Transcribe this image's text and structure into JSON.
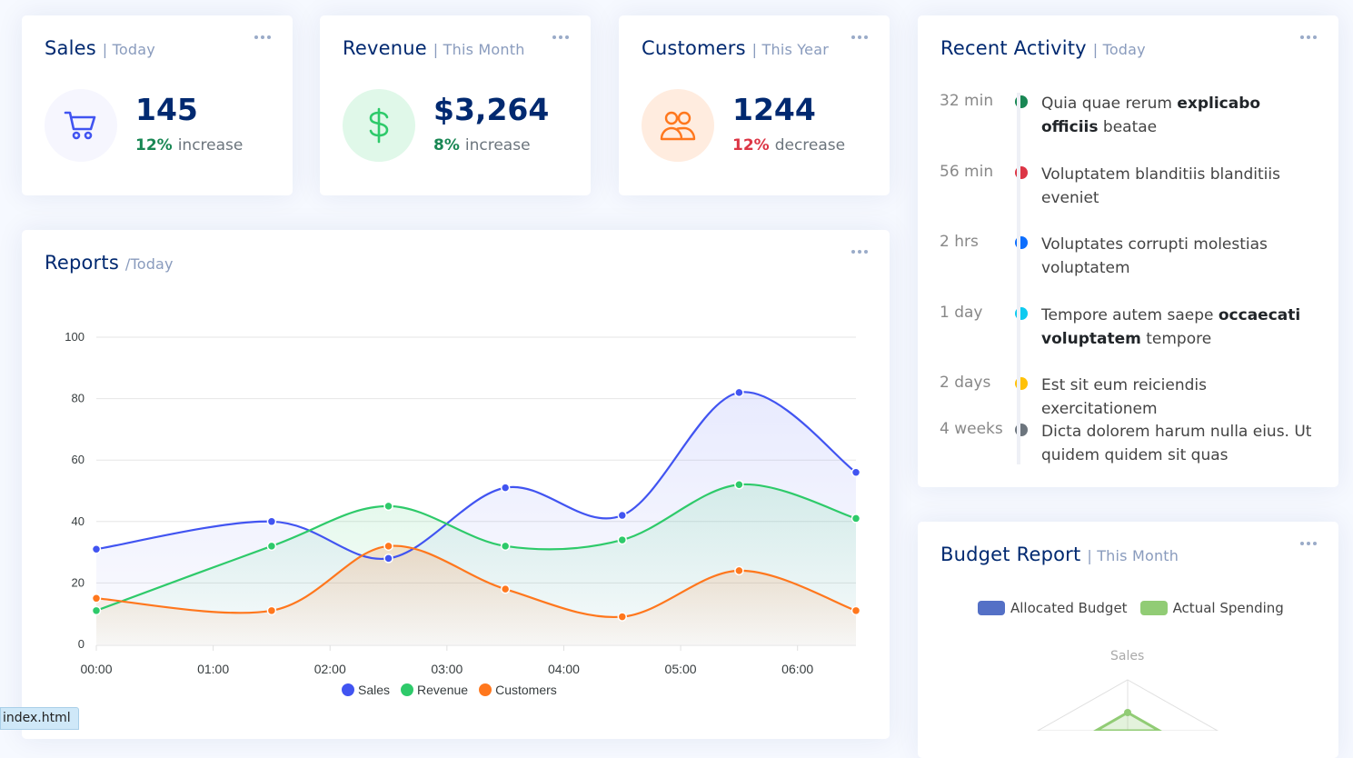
{
  "cards": {
    "sales": {
      "title": "Sales",
      "sub": "| Today",
      "value": "145",
      "pct": "12%",
      "label": "increase",
      "icon": "cart-icon"
    },
    "revenue": {
      "title": "Revenue",
      "sub": "| This Month",
      "value": "$3,264",
      "pct": "8%",
      "label": "increase",
      "icon": "dollar-icon"
    },
    "customers": {
      "title": "Customers",
      "sub": "| This Year",
      "value": "1244",
      "pct": "12%",
      "label": "decrease",
      "icon": "people-icon"
    }
  },
  "reports": {
    "title": "Reports",
    "sub": "/Today"
  },
  "activity": {
    "title": "Recent Activity",
    "sub": "| Today",
    "items": [
      {
        "time": "32 min",
        "pre": "Quia quae rerum ",
        "bold": "explicabo officiis",
        "post": " beatae",
        "color": "#198754"
      },
      {
        "time": "56 min",
        "pre": "Voluptatem blanditiis blanditiis eveniet",
        "bold": "",
        "post": "",
        "color": "#dc3545"
      },
      {
        "time": "2 hrs",
        "pre": "Voluptates corrupti molestias voluptatem",
        "bold": "",
        "post": "",
        "color": "#0d6efd"
      },
      {
        "time": "1 day",
        "pre": "Tempore autem saepe ",
        "bold": "occaecati voluptatem",
        "post": " tempore",
        "color": "#0dcaf0"
      },
      {
        "time": "2 days",
        "pre": "Est sit eum reiciendis exercitationem",
        "bold": "",
        "post": "",
        "color": "#ffc107"
      },
      {
        "time": "4 weeks",
        "pre": "Dicta dolorem harum nulla eius. Ut quidem quidem sit quas",
        "bold": "",
        "post": "",
        "color": "#6c757d"
      }
    ]
  },
  "budget": {
    "title": "Budget Report",
    "sub": "| This Month",
    "legend": [
      {
        "name": "Allocated Budget",
        "color": "#5470c6"
      },
      {
        "name": "Actual Spending",
        "color": "#91cc75"
      }
    ],
    "radar_label": "Sales"
  },
  "chart_data": {
    "type": "area",
    "x": [
      "00:00",
      "01:00",
      "02:00",
      "03:00",
      "04:00",
      "05:00",
      "06:00"
    ],
    "x_values_hours": [
      0,
      1.5,
      2.5,
      3.5,
      4.5,
      5.5,
      6.5
    ],
    "yticks": [
      "0",
      "20",
      "40",
      "60",
      "80",
      "100"
    ],
    "ylim": [
      0,
      100
    ],
    "series": [
      {
        "name": "Sales",
        "color": "#4154f1",
        "values": [
          31,
          40,
          28,
          51,
          42,
          82,
          56
        ]
      },
      {
        "name": "Revenue",
        "color": "#2eca6a",
        "values": [
          11,
          32,
          45,
          32,
          34,
          52,
          41
        ]
      },
      {
        "name": "Customers",
        "color": "#ff771d",
        "values": [
          15,
          11,
          32,
          18,
          9,
          24,
          11
        ]
      }
    ],
    "grid": true,
    "legend_position": "bottom"
  },
  "status_bar": {
    "text": "index.html"
  }
}
